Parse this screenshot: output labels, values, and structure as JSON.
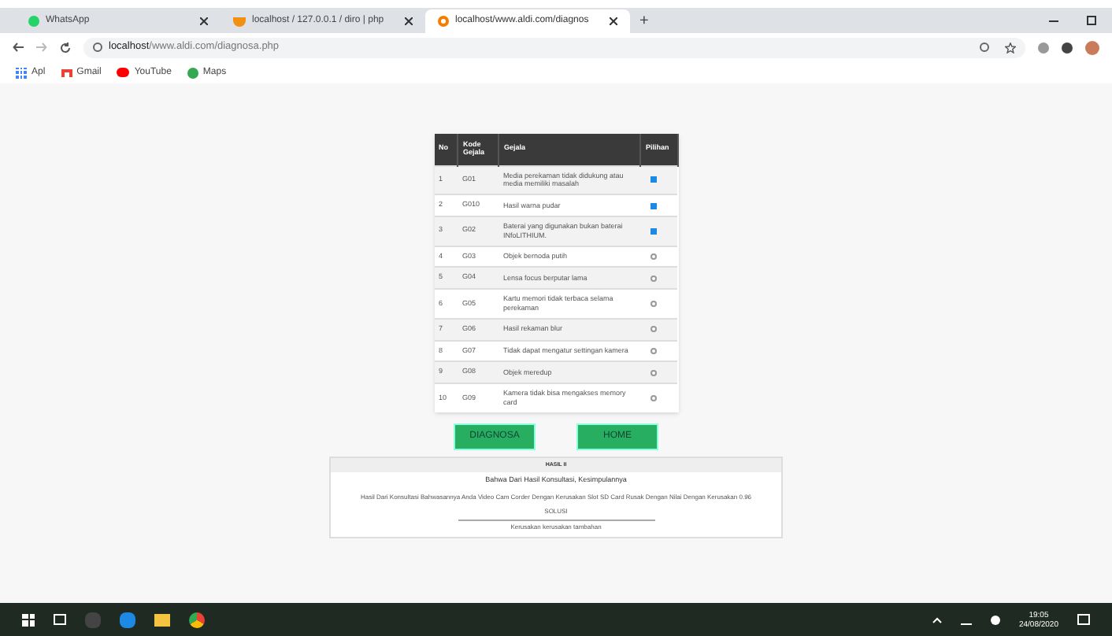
{
  "browser": {
    "tabs": [
      {
        "title": "WhatsApp",
        "kind": "whatsapp",
        "selected": false
      },
      {
        "title": "localhost / 127.0.0.1 / diro | php",
        "kind": "pma",
        "selected": false
      },
      {
        "title": "localhost/www.aldi.com/diagnos",
        "kind": "page",
        "selected": true
      }
    ],
    "new_tab": "+",
    "address": {
      "host": "localhost",
      "path": "/www.aldi.com/diagnosa.php"
    },
    "bookmarks": [
      {
        "label": "Apl",
        "kind": "apps"
      },
      {
        "label": "Gmail",
        "kind": "gmail"
      },
      {
        "label": "YouTube",
        "kind": "youtube"
      },
      {
        "label": "Maps",
        "kind": "maps"
      }
    ]
  },
  "table": {
    "columns": [
      "No",
      "Kode Gejala",
      "Gejala",
      "Pilihan"
    ],
    "rows": [
      {
        "no": "1",
        "code": "G01",
        "symptom": "Media perekaman tidak didukung atau media memiliki masalah",
        "checked": true
      },
      {
        "no": "2",
        "code": "G010",
        "symptom": "Hasil warna pudar",
        "checked": true
      },
      {
        "no": "3",
        "code": "G02",
        "symptom": "Baterai yang digunakan bukan baterai INfoLITHIUM.",
        "checked": true
      },
      {
        "no": "4",
        "code": "G03",
        "symptom": "Objek bernoda putih",
        "checked": false
      },
      {
        "no": "5",
        "code": "G04",
        "symptom": "Lensa focus berputar lama",
        "checked": false
      },
      {
        "no": "6",
        "code": "G05",
        "symptom": "Kartu memori tidak terbaca selama perekaman",
        "checked": false
      },
      {
        "no": "7",
        "code": "G06",
        "symptom": "Hasil rekaman blur",
        "checked": false
      },
      {
        "no": "8",
        "code": "G07",
        "symptom": "Tidak dapat mengatur settingan kamera",
        "checked": false
      },
      {
        "no": "9",
        "code": "G08",
        "symptom": "Objek meredup",
        "checked": false
      },
      {
        "no": "10",
        "code": "G09",
        "symptom": "Kamera tidak bisa mengakses memory card",
        "checked": false
      }
    ]
  },
  "buttons": [
    "DIAGNOSA",
    "HOME"
  ],
  "result": {
    "header": "HASIL II",
    "title": "Bahwa Dari Hasil Konsultasi, Kesimpulannya",
    "text": "Hasil Dari Konsultasi Bahwasannya Anda Video Cam Corder Dengan Kerusakan Slot SD Card Rusak Dengan Nilai Dengan Kerusakan 0.96",
    "solution": "SOLUSI",
    "footer": "Kerusakan kerusakan tambahan"
  },
  "taskbar": {
    "time": "19:05",
    "date": "24/08/2020"
  }
}
